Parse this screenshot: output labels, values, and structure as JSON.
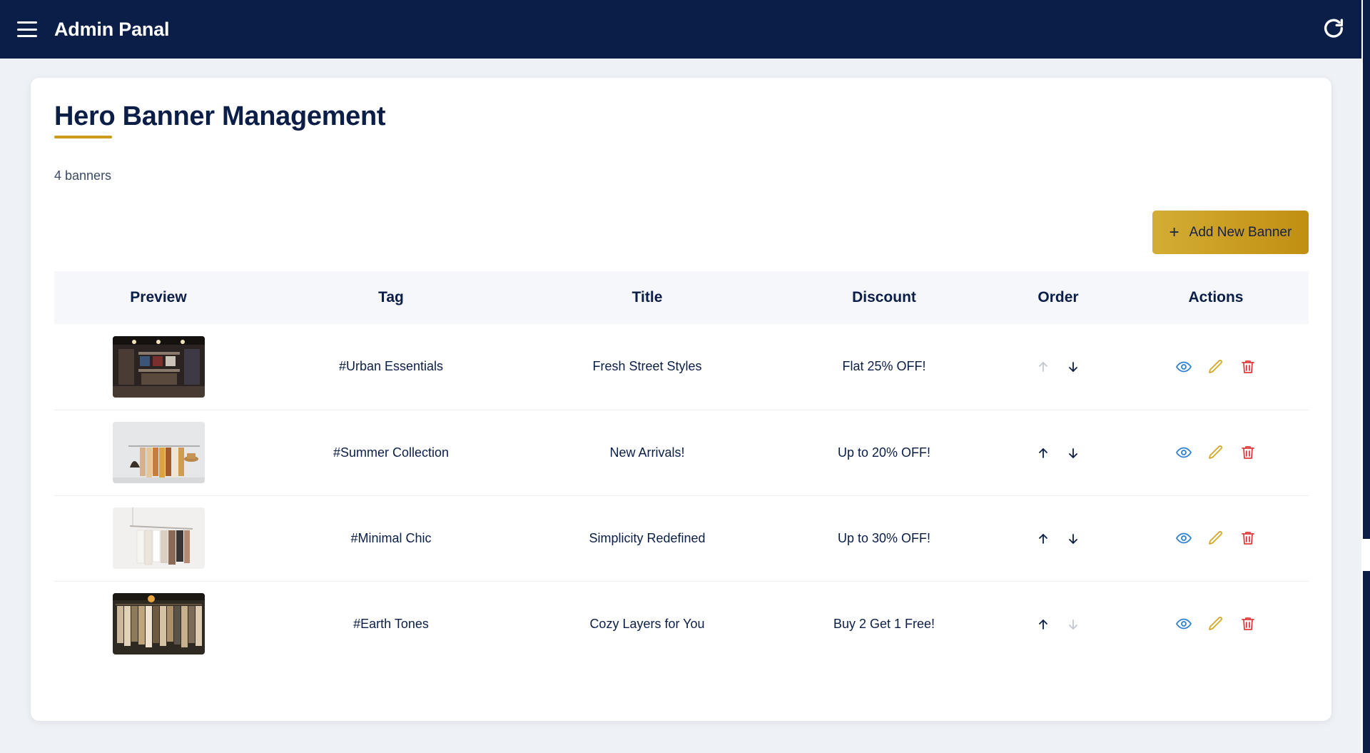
{
  "app": {
    "title": "Admin Panal"
  },
  "page": {
    "title": "Hero Banner Management",
    "count_label": "4 banners",
    "add_button_label": "Add New Banner",
    "add_button_icon": "plus-icon"
  },
  "colors": {
    "navbar": "#0b1e47",
    "accent_gold": "#c99a1c",
    "view_icon": "#2f7fd0",
    "edit_icon": "#d5a823",
    "delete_icon": "#e23b3b"
  },
  "table": {
    "headers": {
      "preview": "Preview",
      "tag": "Tag",
      "title": "Title",
      "discount": "Discount",
      "order": "Order",
      "actions": "Actions"
    },
    "rows": [
      {
        "tag": "#Urban Essentials",
        "title": "Fresh Street Styles",
        "discount": "Flat 25% OFF!",
        "preview": "dark-boutique-shelves",
        "up_enabled": false,
        "down_enabled": true
      },
      {
        "tag": "#Summer Collection",
        "title": "New Arrivals!",
        "discount": "Up to 20% OFF!",
        "preview": "summer-clothes-rack",
        "up_enabled": true,
        "down_enabled": true
      },
      {
        "tag": "#Minimal Chic",
        "title": "Simplicity Redefined",
        "discount": "Up to 30% OFF!",
        "preview": "minimal-hanging-rack",
        "up_enabled": true,
        "down_enabled": true
      },
      {
        "tag": "#Earth Tones",
        "title": "Cozy Layers for You",
        "discount": "Buy 2 Get 1 Free!",
        "preview": "earth-tone-store-rack",
        "up_enabled": true,
        "down_enabled": false
      }
    ]
  }
}
